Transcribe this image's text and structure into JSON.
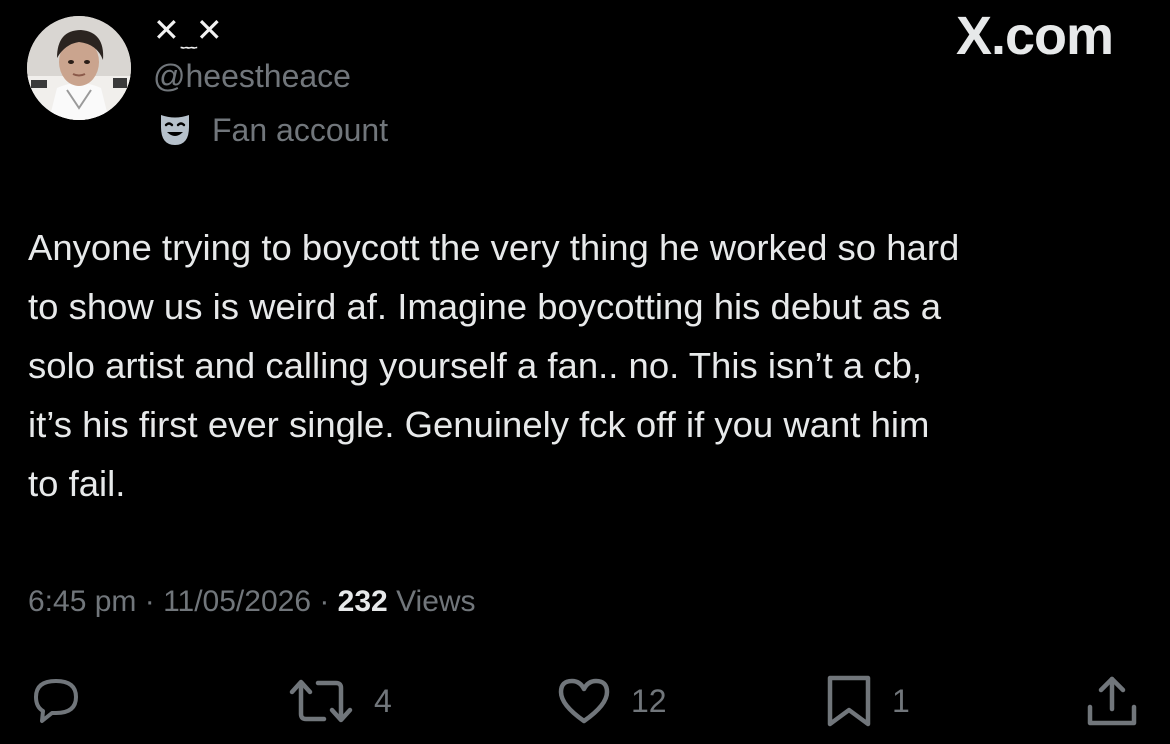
{
  "brand": "X.com",
  "author": {
    "display_name_left": "✕",
    "display_name_mid": "﹏",
    "display_name_right": "✕",
    "handle": "@heestheace",
    "label_icon": "theater-mask-icon",
    "label": "Fan account"
  },
  "tweet": {
    "lines": [
      "Anyone trying to boycott the very thing he worked so hard",
      "to show us is weird af. Imagine boycotting his debut as a",
      "solo artist and calling yourself a fan.. no. This isn’t a cb,",
      "it’s his first ever single. Genuinely fck off if you want him",
      "to fail."
    ]
  },
  "meta": {
    "time": "6:45 pm",
    "sep1": " · ",
    "date": "11/05/2026",
    "sep2": " · ",
    "views_count": "232",
    "views_label": " Views"
  },
  "actions": {
    "reply": {
      "icon": "reply-icon",
      "count": ""
    },
    "repost": {
      "icon": "repost-icon",
      "count": "4"
    },
    "like": {
      "icon": "heart-icon",
      "count": "12"
    },
    "bookmark": {
      "icon": "bookmark-icon",
      "count": "1"
    },
    "share": {
      "icon": "share-icon",
      "count": ""
    }
  },
  "colors": {
    "background": "#000000",
    "primary_text": "#e7e9ea",
    "secondary_text": "#71767b"
  }
}
